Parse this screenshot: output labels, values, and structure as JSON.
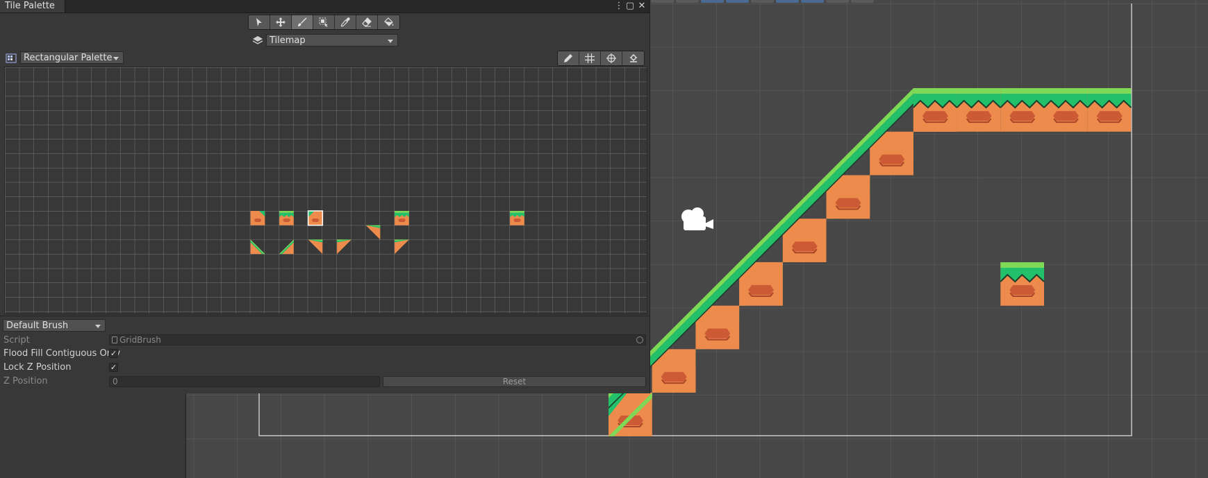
{
  "window": {
    "tab_title": "Tile Palette",
    "menu_glyph": "⋮",
    "maximize_glyph": "▢",
    "close_glyph": "✕"
  },
  "tools": [
    {
      "name": "select-tool",
      "icon": "cursor-arrow-icon"
    },
    {
      "name": "move-tool",
      "icon": "move-arrows-icon"
    },
    {
      "name": "paint-tool",
      "icon": "paintbrush-icon"
    },
    {
      "name": "box-fill-tool",
      "icon": "box-fill-icon"
    },
    {
      "name": "picker-tool",
      "icon": "eyedropper-icon"
    },
    {
      "name": "erase-tool",
      "icon": "eraser-icon"
    },
    {
      "name": "flood-fill-tool",
      "icon": "paint-bucket-icon"
    }
  ],
  "active_tool": "paint-tool",
  "target": {
    "selected": "Tilemap"
  },
  "palette": {
    "selected": "Rectangular Palette"
  },
  "palette_tools": [
    {
      "name": "edit-palette",
      "icon": "pencil-icon"
    },
    {
      "name": "toggle-grid",
      "icon": "grid-icon"
    },
    {
      "name": "gizmos",
      "icon": "gizmo-icon"
    },
    {
      "name": "palette-settings",
      "icon": "palette-settings-icon"
    }
  ],
  "brush": {
    "selected": "Default Brush",
    "script_label": "Script",
    "script_value": "GridBrush",
    "flood_fill_label": "Flood Fill Contiguous Only",
    "flood_fill_checked": true,
    "lock_z_label": "Lock Z Position",
    "lock_z_checked": true,
    "z_position_label": "Z Position",
    "z_position_value": "0",
    "reset_label": "Reset",
    "check_glyph": "✓"
  },
  "colors": {
    "grass_light": "#7ed957",
    "grass": "#22c06a",
    "grass_dark": "#1a9a52",
    "dirt": "#ec8b4c",
    "dirt_rock": "#cc5a35",
    "dirt_rock_shadow": "#a84428"
  }
}
